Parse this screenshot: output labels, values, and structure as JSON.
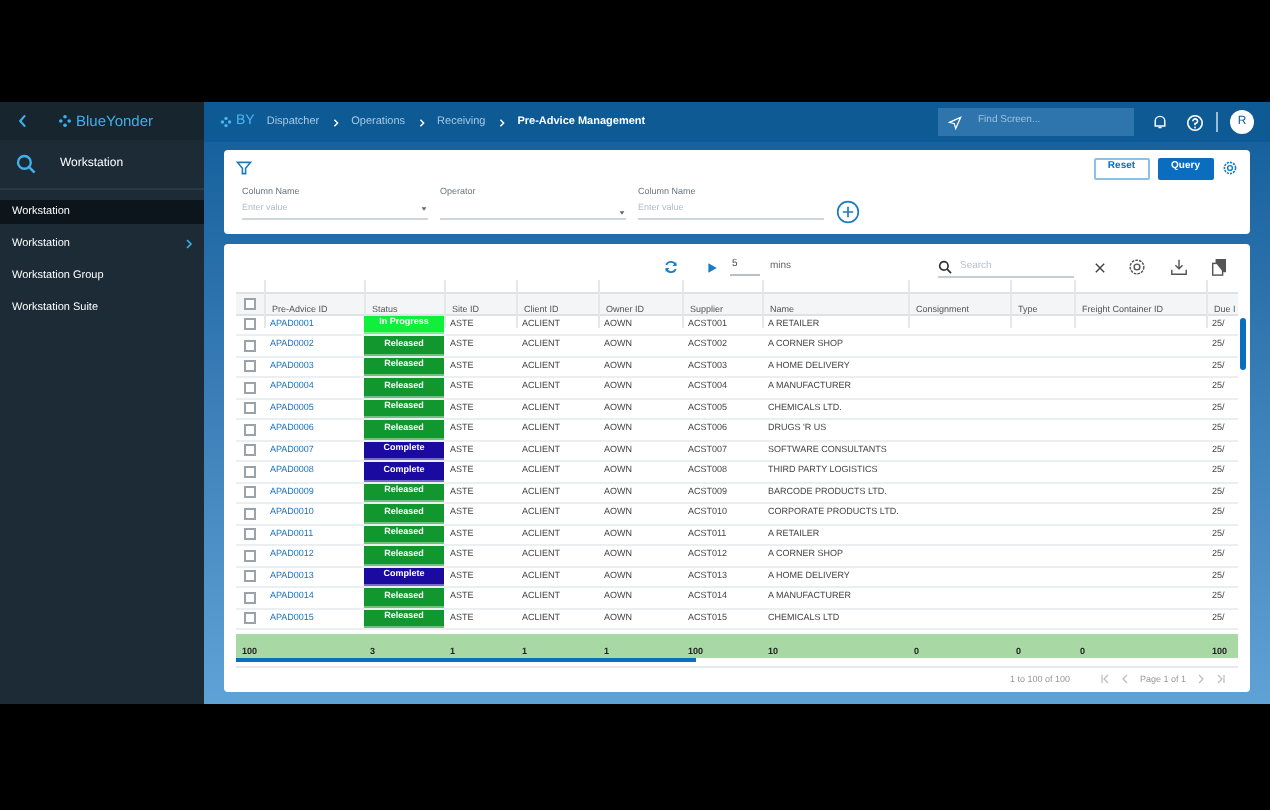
{
  "sidebar": {
    "logo": "BlueYonder",
    "search_label": "Workstation",
    "items": [
      {
        "label": "Workstation",
        "selected": true,
        "has_children": false
      },
      {
        "label": "Workstation",
        "selected": false,
        "has_children": true
      },
      {
        "label": "Workstation Group",
        "selected": false,
        "has_children": false
      },
      {
        "label": "Workstation Suite",
        "selected": false,
        "has_children": false
      }
    ]
  },
  "topbar": {
    "logo": "BY",
    "breadcrumbs": [
      "Dispatcher",
      "Operations",
      "Receiving",
      "Pre-Advice Management"
    ],
    "search": {
      "placeholder": "Find Screen..."
    },
    "avatar": "R"
  },
  "filter": {
    "fields": [
      {
        "label": "Column Name",
        "placeholder": "Enter value",
        "dropdown": true
      },
      {
        "label": "Operator",
        "dropdown": true
      },
      {
        "label": "Column Name",
        "placeholder": "Enter value",
        "dropdown": false
      }
    ],
    "buttons": [
      {
        "label": "Reset",
        "kind": "outline"
      },
      {
        "label": "Query",
        "kind": "primary"
      }
    ]
  },
  "table": {
    "all_checked": false,
    "refresh_interval": "5",
    "interval_unit": "mins",
    "search": {
      "placeholder": "Search"
    },
    "columns": [
      "Pre-Advice ID",
      "Status",
      "Site ID",
      "Client ID",
      "Owner ID",
      "Supplier",
      "Name",
      "Consignment",
      "Type",
      "Freight Container ID",
      "Due I"
    ],
    "rows": [
      {
        "checked": false,
        "id": "APAD0001",
        "status": {
          "label": "In Progress",
          "color": "#10f03a"
        },
        "site": "ASTE",
        "client": "ACLIENT",
        "owner": "AOWN",
        "supplier": "ACST001",
        "name": "A RETAILER",
        "due": "25/"
      },
      {
        "checked": false,
        "id": "APAD0002",
        "status": {
          "label": "Released",
          "color": "#12962e"
        },
        "site": "ASTE",
        "client": "ACLIENT",
        "owner": "AOWN",
        "supplier": "ACST002",
        "name": "A CORNER SHOP",
        "due": "25/"
      },
      {
        "checked": false,
        "id": "APAD0003",
        "status": {
          "label": "Released",
          "color": "#12962e"
        },
        "site": "ASTE",
        "client": "ACLIENT",
        "owner": "AOWN",
        "supplier": "ACST003",
        "name": "A HOME DELIVERY",
        "due": "25/"
      },
      {
        "checked": false,
        "id": "APAD0004",
        "status": {
          "label": "Released",
          "color": "#12962e"
        },
        "site": "ASTE",
        "client": "ACLIENT",
        "owner": "AOWN",
        "supplier": "ACST004",
        "name": "A MANUFACTURER",
        "due": "25/"
      },
      {
        "checked": false,
        "id": "APAD0005",
        "status": {
          "label": "Released",
          "color": "#12962e"
        },
        "site": "ASTE",
        "client": "ACLIENT",
        "owner": "AOWN",
        "supplier": "ACST005",
        "name": "CHEMICALS LTD.",
        "due": "25/"
      },
      {
        "checked": false,
        "id": "APAD0006",
        "status": {
          "label": "Released",
          "color": "#12962e"
        },
        "site": "ASTE",
        "client": "ACLIENT",
        "owner": "AOWN",
        "supplier": "ACST006",
        "name": "DRUGS 'R US",
        "due": "25/"
      },
      {
        "checked": false,
        "id": "APAD0007",
        "status": {
          "label": "Complete",
          "color": "#1a0aa0"
        },
        "site": "ASTE",
        "client": "ACLIENT",
        "owner": "AOWN",
        "supplier": "ACST007",
        "name": "SOFTWARE CONSULTANTS",
        "due": "25/"
      },
      {
        "checked": false,
        "id": "APAD0008",
        "status": {
          "label": "Complete",
          "color": "#1a0aa0"
        },
        "site": "ASTE",
        "client": "ACLIENT",
        "owner": "AOWN",
        "supplier": "ACST008",
        "name": "THIRD PARTY LOGISTICS",
        "due": "25/"
      },
      {
        "checked": false,
        "id": "APAD0009",
        "status": {
          "label": "Released",
          "color": "#12962e"
        },
        "site": "ASTE",
        "client": "ACLIENT",
        "owner": "AOWN",
        "supplier": "ACST009",
        "name": "BARCODE PRODUCTS LTD.",
        "due": "25/"
      },
      {
        "checked": false,
        "id": "APAD0010",
        "status": {
          "label": "Released",
          "color": "#12962e"
        },
        "site": "ASTE",
        "client": "ACLIENT",
        "owner": "AOWN",
        "supplier": "ACST010",
        "name": "CORPORATE PRODUCTS LTD.",
        "due": "25/"
      },
      {
        "checked": false,
        "id": "APAD0011",
        "status": {
          "label": "Released",
          "color": "#12962e"
        },
        "site": "ASTE",
        "client": "ACLIENT",
        "owner": "AOWN",
        "supplier": "ACST011",
        "name": "A RETAILER",
        "due": "25/"
      },
      {
        "checked": false,
        "id": "APAD0012",
        "status": {
          "label": "Released",
          "color": "#12962e"
        },
        "site": "ASTE",
        "client": "ACLIENT",
        "owner": "AOWN",
        "supplier": "ACST012",
        "name": "A CORNER SHOP",
        "due": "25/"
      },
      {
        "checked": false,
        "id": "APAD0013",
        "status": {
          "label": "Complete",
          "color": "#1a0aa0"
        },
        "site": "ASTE",
        "client": "ACLIENT",
        "owner": "AOWN",
        "supplier": "ACST013",
        "name": "A HOME DELIVERY",
        "due": "25/"
      },
      {
        "checked": false,
        "id": "APAD0014",
        "status": {
          "label": "Released",
          "color": "#12962e"
        },
        "site": "ASTE",
        "client": "ACLIENT",
        "owner": "AOWN",
        "supplier": "ACST014",
        "name": "A MANUFACTURER",
        "due": "25/"
      },
      {
        "checked": false,
        "id": "APAD0015",
        "status": {
          "label": "Released",
          "color": "#12962e"
        },
        "site": "ASTE",
        "client": "ACLIENT",
        "owner": "AOWN",
        "supplier": "ACST015",
        "name": "CHEMICALS LTD",
        "due": "25/"
      }
    ],
    "totals": [
      "100",
      "3",
      "1",
      "1",
      "1",
      "100",
      "10",
      "0",
      "0",
      "0",
      "100"
    ],
    "pagination": {
      "range": "1 to 100 of 100",
      "page": "Page 1 of 1"
    }
  }
}
